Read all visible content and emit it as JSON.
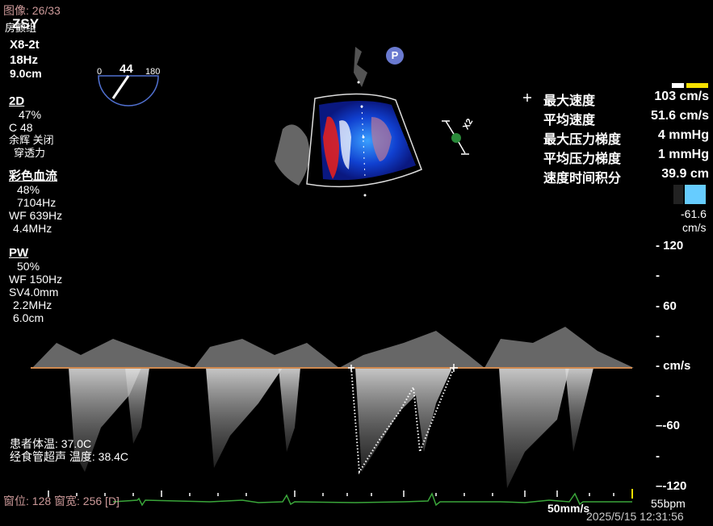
{
  "header": {
    "image_counter": "图像: 26/33",
    "patient_code": "ZSY",
    "hospital_name": "房颤组",
    "probe": "X8-2t",
    "frame_rate": "18Hz",
    "depth": "9.0cm"
  },
  "probe_angle": {
    "value": "44",
    "min": "0",
    "max": "180"
  },
  "mode_2d": {
    "title": "2D",
    "gain": "47%",
    "compress": "C 48",
    "persist": "余辉 关闭",
    "penetration": "穿透力"
  },
  "color_flow": {
    "title": "彩色血流",
    "gain": "48%",
    "prf": "7104Hz",
    "wall_filter": "WF 639Hz",
    "freq": "4.4MHz"
  },
  "pw": {
    "title": "PW",
    "gain": "50%",
    "wall_filter": "WF 150Hz",
    "sample_volume": "SV4.0mm",
    "freq": "2.2MHz",
    "depth": "6.0cm"
  },
  "zoom_badge": "P",
  "zoom_label": "X2",
  "measurements": [
    {
      "label": "最大速度",
      "value": "103 cm/s"
    },
    {
      "label": "平均速度",
      "value": "51.6 cm/s"
    },
    {
      "label": "最大压力梯度",
      "value": "4 mmHg"
    },
    {
      "label": "平均压力梯度",
      "value": "1 mmHg"
    },
    {
      "label": "速度时间积分",
      "value": "39.9 cm"
    }
  ],
  "color_scale": {
    "value": "-61.6",
    "unit": "cm/s",
    "colors": {
      "positive": "#ffffff",
      "negative": "#66ccff"
    }
  },
  "velocity_scale": {
    "ticks": [
      {
        "label": "120",
        "prefix": "- "
      },
      {
        "label": "",
        "prefix": "-"
      },
      {
        "label": "60",
        "prefix": "- "
      },
      {
        "label": "",
        "prefix": "-"
      },
      {
        "label": "cm/s",
        "prefix": "- "
      },
      {
        "label": "",
        "prefix": "-"
      },
      {
        "label": "-60",
        "prefix": "–"
      },
      {
        "label": "",
        "prefix": "-"
      },
      {
        "label": "-120",
        "prefix": "–"
      }
    ]
  },
  "temperatures": {
    "patient": "患者体温: 37.0C",
    "probe": "经食管超声 温度: 38.4C"
  },
  "window_level": "窗位: 128 窗宽: 256 [D]",
  "sweep_speed": "50mm/s",
  "heart_rate": "55bpm",
  "datetime": "2025/5/15 12:31:56",
  "colors": {
    "baseline": "#d08a50",
    "ecg": "#3aa63a",
    "trace": "#ffffff",
    "pink_text": "#cc9999"
  }
}
